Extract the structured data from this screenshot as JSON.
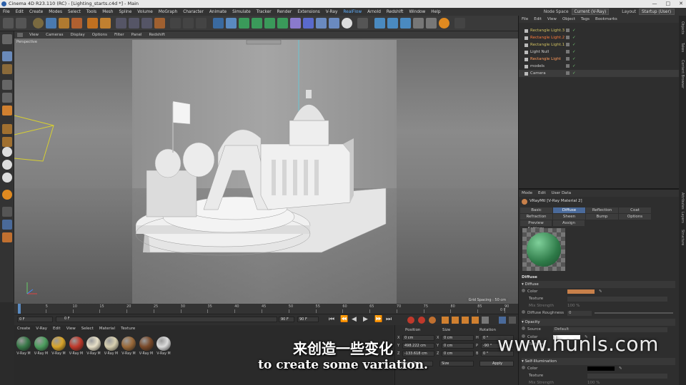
{
  "window": {
    "title": "Cinema 4D R23.110 (RC) - [Lighting_starts.c4d *] - Main",
    "controls": [
      "—",
      "□",
      "✕"
    ]
  },
  "menu": {
    "items": [
      "File",
      "Edit",
      "Create",
      "Modes",
      "Select",
      "Tools",
      "Mesh",
      "Spline",
      "Volume",
      "MoGraph",
      "Character",
      "Animate",
      "Simulate",
      "Tracker",
      "Render",
      "Extensions",
      "V-Ray",
      "RealFlow",
      "Arnold",
      "Redshift",
      "Window",
      "Help"
    ],
    "node_space_label": "Node Space",
    "node_space_value": "Current (V-Ray)",
    "layout_label": "Layout",
    "layout_value": "Startup (User)"
  },
  "viewport": {
    "menu": [
      "View",
      "Cameras",
      "Display",
      "Options",
      "Filter",
      "Panel",
      "Redshift"
    ],
    "label": "Perspective",
    "grid_spacing": "Grid Spacing : 50 cm"
  },
  "timeline": {
    "ticks": [
      "0",
      "5",
      "10",
      "15",
      "20",
      "25",
      "30",
      "35",
      "40",
      "45",
      "50",
      "55",
      "60",
      "65",
      "70",
      "75",
      "80",
      "85",
      "90"
    ],
    "current_frame_marker": "0 F",
    "start_field": "0 F",
    "current_field": "0 F",
    "end_field": "90 F",
    "end_field2": "90 F"
  },
  "material_manager": {
    "menu": [
      "Create",
      "V-Ray",
      "Edit",
      "View",
      "Select",
      "Material",
      "Texture"
    ],
    "materials": [
      {
        "label": "V-Ray M",
        "color": "#3a7a4a"
      },
      {
        "label": "V-Ray M",
        "color": "#4d9e5e"
      },
      {
        "label": "V-Ray M",
        "color": "#d9a52a"
      },
      {
        "label": "V-Ray M",
        "color": "#c0392b"
      },
      {
        "label": "V-Ray M",
        "color": "#e8e0c8"
      },
      {
        "label": "V-Ray M",
        "color": "#d8d0b0"
      },
      {
        "label": "V-Ray M",
        "color": "#9a6a3a"
      },
      {
        "label": "V-Ray M",
        "color": "#7a4a2a"
      },
      {
        "label": "V-Ray M",
        "color": "#dcdcdc"
      }
    ]
  },
  "coordinates": {
    "headers": [
      "Position",
      "Size",
      "Rotation"
    ],
    "rows": [
      {
        "axis": "X",
        "pos": "0 cm",
        "size_axis": "X",
        "size": "0 cm",
        "rot_axis": "H",
        "rot": "0 °"
      },
      {
        "axis": "Y",
        "pos": "498.222 cm",
        "size_axis": "Y",
        "size": "0 cm",
        "rot_axis": "P",
        "rot": "-90 °"
      },
      {
        "axis": "Z",
        "pos": "-133.618 cm",
        "size_axis": "Z",
        "size": "0 cm",
        "rot_axis": "B",
        "rot": "0 °"
      }
    ],
    "mode": "Object (Rel)",
    "size_mode": "Size",
    "apply": "Apply"
  },
  "object_manager": {
    "menu": [
      "File",
      "Edit",
      "View",
      "Object",
      "Tags",
      "Bookmarks"
    ],
    "objects": [
      {
        "name": "Rectangle Light.3",
        "color": "#d0c060",
        "selected": false
      },
      {
        "name": "Rectangle Light.2",
        "color": "#ff7a3a",
        "selected": false
      },
      {
        "name": "Rectangle Light.1",
        "color": "#d0c060",
        "selected": false
      },
      {
        "name": "Light Null",
        "color": "#cccccc",
        "selected": false
      },
      {
        "name": "Rectangle Light",
        "color": "#ff9a5a",
        "selected": false
      },
      {
        "name": "models",
        "color": "#cccccc",
        "selected": false
      },
      {
        "name": "Camera",
        "color": "#cccccc",
        "selected": true
      }
    ]
  },
  "attribute_manager": {
    "menu": [
      "Mode",
      "Edit",
      "User Data"
    ],
    "material_title": "VRayMtl [V-Ray Material 2]",
    "tabs_row1": [
      "Basic",
      "Diffuse",
      "Reflection",
      "Coat"
    ],
    "tabs_row2": [
      "Refraction",
      "Sheen",
      "Bump",
      "Options"
    ],
    "tabs_row3": [
      "Preview Settings",
      "Assign"
    ],
    "active_tab": "Diffuse",
    "section_title": "Diffuse",
    "diffuse_group": "Diffuse",
    "color_label": "Color",
    "diffuse_color": "#c8804a",
    "texture_label": "Texture",
    "mix_strength_label": "Mix Strength",
    "mix_strength_value": "100 %",
    "roughness_label": "Diffuse Roughness",
    "roughness_value": "0",
    "opacity_group": "Opacity",
    "source_label": "Source",
    "source_value": "Default",
    "opacity_color_label": "Color",
    "opacity_color": "#ffffff",
    "opacity_texture_label": "Texture",
    "self_illum_group": "Self-Illumination",
    "self_color_label": "Color",
    "self_color": "#000000",
    "self_texture_label": "Texture",
    "self_mix_label": "Mix Strength",
    "self_mix_value": "100 %"
  },
  "side_tabs": [
    "Objects",
    "Takes",
    "Content Browser",
    "Attributes",
    "Layers",
    "Structure"
  ],
  "subtitles": {
    "chinese": "来创造一些变化",
    "english": "to create some variation."
  },
  "watermark": "www.hunls.com"
}
